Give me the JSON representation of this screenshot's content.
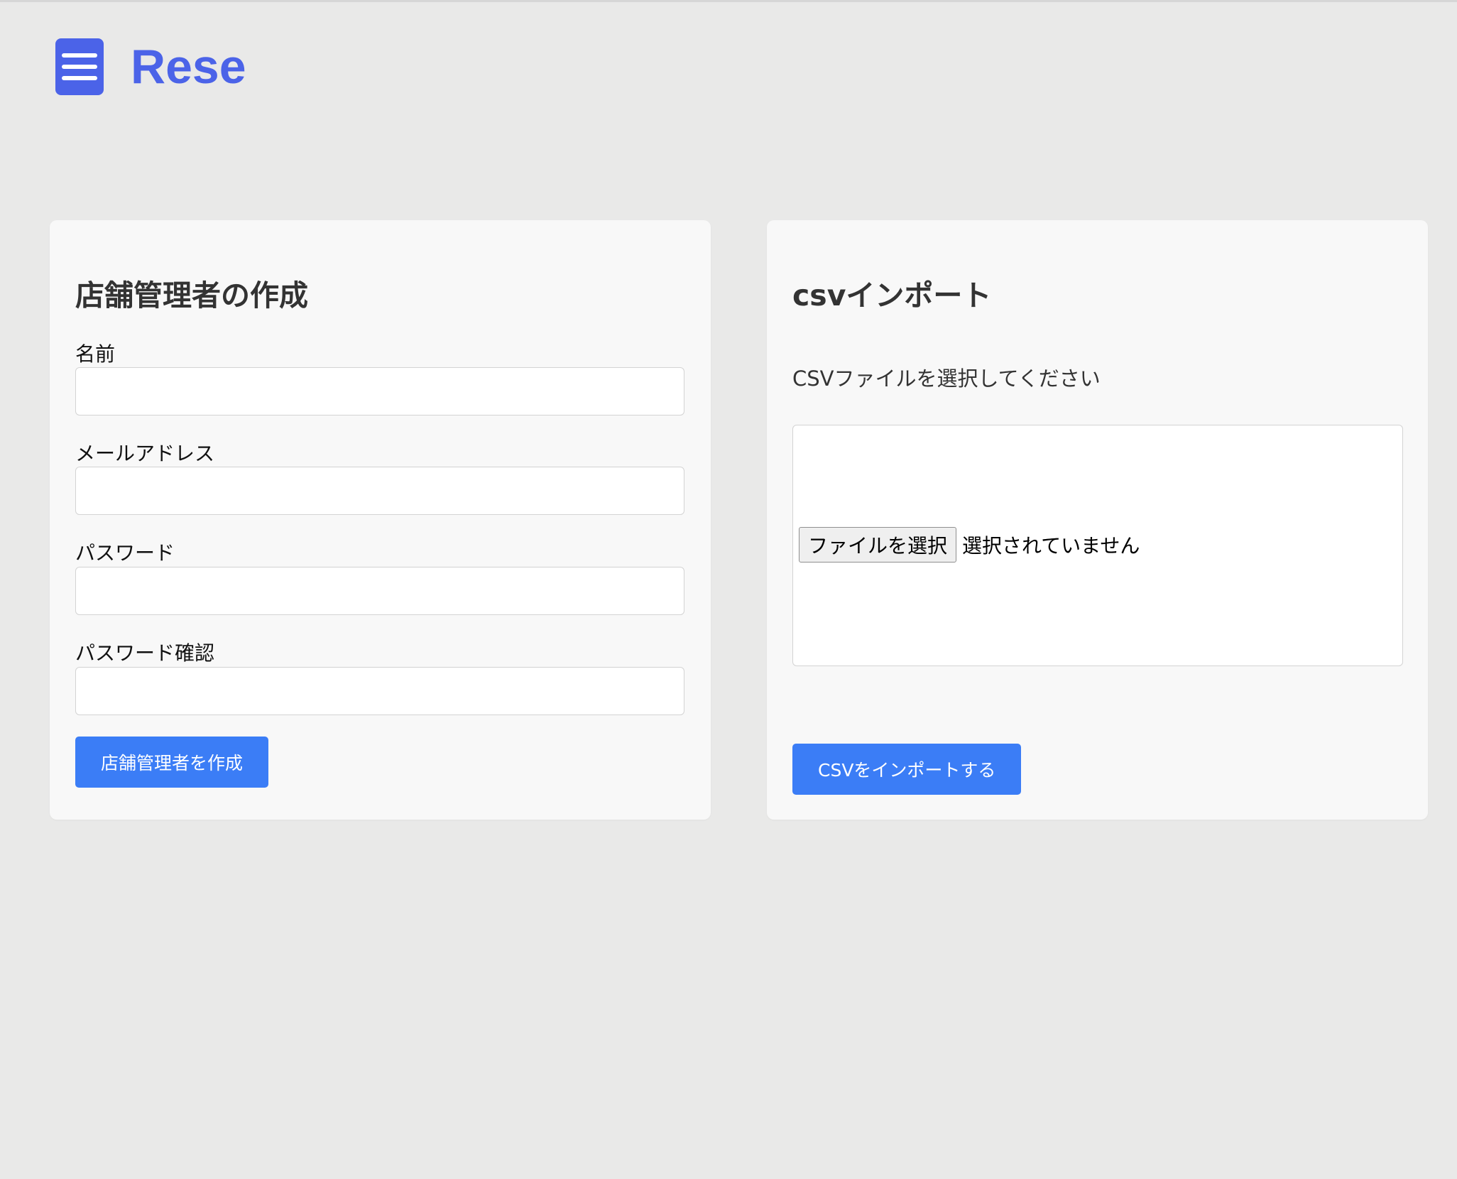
{
  "header": {
    "logo": "Rese",
    "menu_icon": "hamburger-menu-icon"
  },
  "create_manager": {
    "title": "店舗管理者の作成",
    "fields": [
      {
        "label": "名前",
        "value": ""
      },
      {
        "label": "メールアドレス",
        "value": ""
      },
      {
        "label": "パスワード",
        "value": ""
      },
      {
        "label": "パスワード確認",
        "value": ""
      }
    ],
    "submit_label": "店舗管理者を作成"
  },
  "csv_import": {
    "title": "csvインポート",
    "instruction": "CSVファイルを選択してください",
    "file_button_label": "ファイルを選択",
    "file_status": "選択されていません",
    "submit_label": "CSVをインポートする"
  },
  "colors": {
    "background": "#e9e9e8",
    "card": "#f8f8f8",
    "brand": "#4b63e8",
    "button": "#3b7df6"
  }
}
